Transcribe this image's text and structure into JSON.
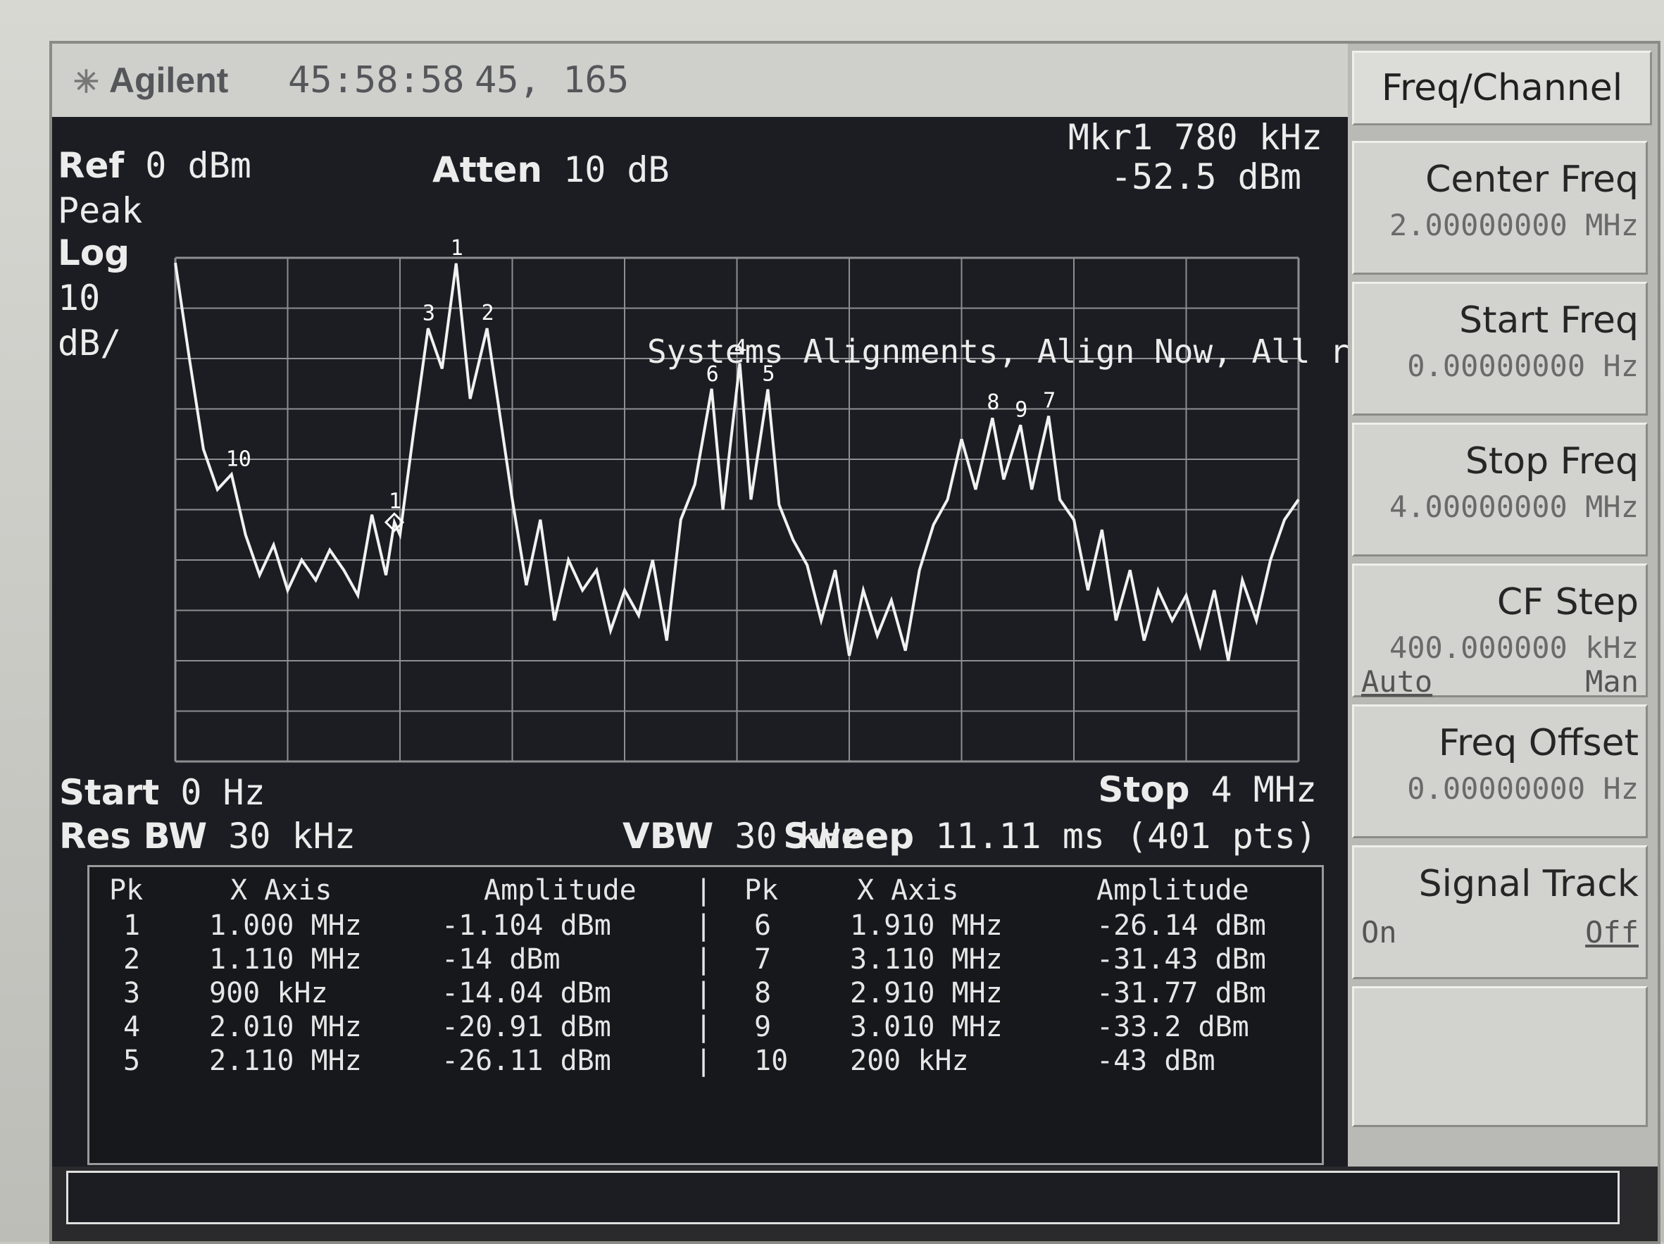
{
  "topbar": {
    "logo": "Agilent",
    "time": "45:58:58",
    "coords": "45, 165"
  },
  "graph": {
    "ref_label": "Ref",
    "ref_value": "0 dBm",
    "atten_label": "Atten",
    "atten_value": "10 dB",
    "marker_line1": "Mkr1  780 kHz",
    "marker_line2": "-52.5 dBm",
    "detector": "Peak",
    "scale_type": "Log",
    "scale_div": "10",
    "scale_unit": "dB/",
    "alert": "Systems Alignments, Align Now, All required",
    "start_label": "Start",
    "start_value": "0 Hz",
    "stop_label": "Stop",
    "stop_value": "4 MHz",
    "rbw_label": "Res BW",
    "rbw_value": "30 kHz",
    "vbw_label": "VBW",
    "vbw_value": "30 kHz",
    "sweep_label": "Sweep",
    "sweep_value": "11.11 ms (401 pts)",
    "trace_color": "#f2f2f2",
    "grid_color": "#8e8e92"
  },
  "chart_data": {
    "type": "line",
    "xlim": [
      0,
      4
    ],
    "ylim": [
      -100,
      0
    ],
    "x_unit": "MHz",
    "y_unit": "dBm",
    "x_divisions": 10,
    "y_divisions": 10,
    "trace": {
      "x": [
        0,
        0.05,
        0.1,
        0.15,
        0.2,
        0.25,
        0.3,
        0.35,
        0.4,
        0.45,
        0.5,
        0.55,
        0.6,
        0.65,
        0.7,
        0.75,
        0.78,
        0.8,
        0.85,
        0.9,
        0.95,
        1.0,
        1.05,
        1.11,
        1.15,
        1.2,
        1.25,
        1.3,
        1.35,
        1.4,
        1.45,
        1.5,
        1.55,
        1.6,
        1.65,
        1.7,
        1.75,
        1.8,
        1.85,
        1.91,
        1.95,
        2.01,
        2.05,
        2.11,
        2.15,
        2.2,
        2.25,
        2.3,
        2.35,
        2.4,
        2.45,
        2.5,
        2.55,
        2.6,
        2.65,
        2.7,
        2.75,
        2.8,
        2.85,
        2.91,
        2.95,
        3.01,
        3.05,
        3.11,
        3.15,
        3.2,
        3.25,
        3.3,
        3.35,
        3.4,
        3.45,
        3.5,
        3.55,
        3.6,
        3.65,
        3.7,
        3.75,
        3.8,
        3.85,
        3.9,
        3.95,
        4.0
      ],
      "y": [
        -1,
        -20,
        -38,
        -46,
        -43,
        -55,
        -63,
        -57,
        -66,
        -60,
        -64,
        -58,
        -62,
        -67,
        -51,
        -63,
        -52.5,
        -55,
        -34,
        -14,
        -22,
        -1.1,
        -28,
        -14,
        -29,
        -48,
        -65,
        -52,
        -72,
        -60,
        -66,
        -62,
        -74,
        -66,
        -71,
        -60,
        -76,
        -52,
        -45,
        -26,
        -50,
        -20.9,
        -48,
        -26.1,
        -49,
        -56,
        -61,
        -72,
        -62,
        -79,
        -66,
        -75,
        -68,
        -78,
        -62,
        -53,
        -48,
        -36,
        -46,
        -31.8,
        -44,
        -33.2,
        -46,
        -31.4,
        -48,
        -52,
        -66,
        -54,
        -72,
        -62,
        -76,
        -66,
        -72,
        -67,
        -77,
        -66,
        -80,
        -64,
        -72,
        -60,
        -52,
        -48
      ]
    },
    "markers": [
      {
        "label": "1",
        "x": 0.78,
        "y": -52.5,
        "active": true
      },
      {
        "label": "1",
        "x": 1.0,
        "y": -1.104
      },
      {
        "label": "2",
        "x": 1.11,
        "y": -14
      },
      {
        "label": "3",
        "x": 0.9,
        "y": -14.04
      },
      {
        "label": "4",
        "x": 2.01,
        "y": -20.91
      },
      {
        "label": "5",
        "x": 2.11,
        "y": -26.11
      },
      {
        "label": "6",
        "x": 1.91,
        "y": -26.14
      },
      {
        "label": "7",
        "x": 3.11,
        "y": -31.43
      },
      {
        "label": "8",
        "x": 2.91,
        "y": -31.77
      },
      {
        "label": "9",
        "x": 3.01,
        "y": -33.2
      },
      {
        "label": "10",
        "x": 0.2,
        "y": -43
      }
    ]
  },
  "peak_table": {
    "headers": {
      "pk": "Pk",
      "x": "X Axis",
      "amp": "Amplitude",
      "sep": "|"
    },
    "left": [
      {
        "pk": "1",
        "x": "1.000 MHz",
        "amp": "-1.104 dBm"
      },
      {
        "pk": "2",
        "x": "1.110 MHz",
        "amp": "-14 dBm"
      },
      {
        "pk": "3",
        "x": "900 kHz",
        "amp": "-14.04 dBm"
      },
      {
        "pk": "4",
        "x": "2.010 MHz",
        "amp": "-20.91 dBm"
      },
      {
        "pk": "5",
        "x": "2.110 MHz",
        "amp": "-26.11 dBm"
      }
    ],
    "right": [
      {
        "pk": "6",
        "x": "1.910 MHz",
        "amp": "-26.14 dBm"
      },
      {
        "pk": "7",
        "x": "3.110 MHz",
        "amp": "-31.43 dBm"
      },
      {
        "pk": "8",
        "x": "2.910 MHz",
        "amp": "-31.77 dBm"
      },
      {
        "pk": "9",
        "x": "3.010 MHz",
        "amp": "-33.2 dBm"
      },
      {
        "pk": "10",
        "x": "200 kHz",
        "amp": "-43 dBm"
      }
    ]
  },
  "softkeys": {
    "title": "Freq/Channel",
    "keys": [
      {
        "label": "Center Freq",
        "value": "2.00000000 MHz"
      },
      {
        "label": "Start Freq",
        "value": "0.00000000  Hz"
      },
      {
        "label": "Stop Freq",
        "value": "4.00000000 MHz"
      },
      {
        "label": "CF Step",
        "value": "400.000000 kHz",
        "opt_left": "Auto",
        "opt_right": "Man"
      },
      {
        "label": "Freq Offset",
        "value": "0.00000000  Hz"
      },
      {
        "label": "Signal Track",
        "opt_left": "On",
        "opt_right": "Off"
      }
    ]
  }
}
